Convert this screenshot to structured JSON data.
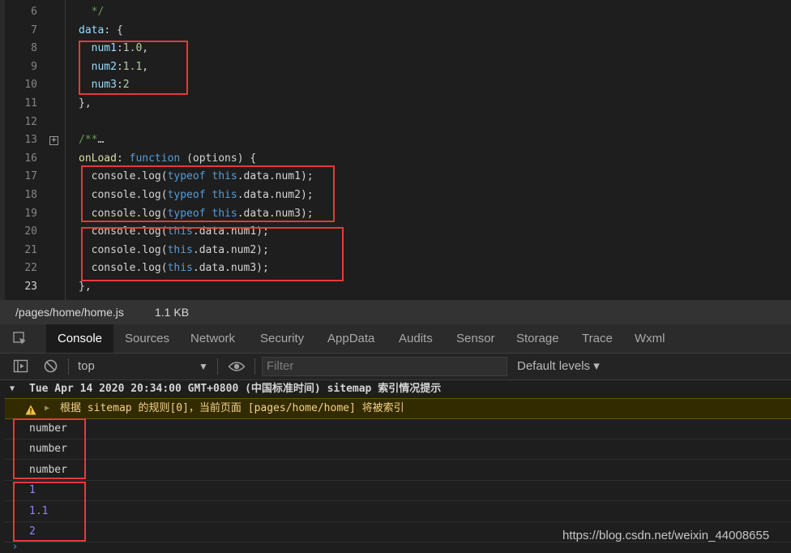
{
  "editor": {
    "current_line": "23",
    "lines": [
      {
        "num": "6",
        "parts": [
          {
            "t": "  */",
            "c": "t-c"
          }
        ]
      },
      {
        "num": "7",
        "parts": [
          {
            "t": "data",
            "c": "t-p"
          },
          {
            "t": ": {",
            "c": "t-d"
          }
        ]
      },
      {
        "num": "8",
        "parts": [
          {
            "t": "  num1",
            "c": "t-p"
          },
          {
            "t": ":",
            "c": "t-d"
          },
          {
            "t": "1.0",
            "c": "t-n"
          },
          {
            "t": ",",
            "c": "t-d"
          }
        ]
      },
      {
        "num": "9",
        "parts": [
          {
            "t": "  num2",
            "c": "t-p"
          },
          {
            "t": ":",
            "c": "t-d"
          },
          {
            "t": "1.1",
            "c": "t-n"
          },
          {
            "t": ",",
            "c": "t-d"
          }
        ]
      },
      {
        "num": "10",
        "parts": [
          {
            "t": "  num3",
            "c": "t-p"
          },
          {
            "t": ":",
            "c": "t-d"
          },
          {
            "t": "2",
            "c": "t-n"
          }
        ]
      },
      {
        "num": "11",
        "parts": [
          {
            "t": "},",
            "c": "t-d"
          }
        ]
      },
      {
        "num": "12",
        "parts": []
      },
      {
        "num": "13",
        "fold": "+",
        "parts": [
          {
            "t": "/**",
            "c": "t-c"
          },
          {
            "t": "…",
            "c": "t-d"
          }
        ]
      },
      {
        "num": "16",
        "parts": [
          {
            "t": "onLoad",
            "c": "t-f"
          },
          {
            "t": ": ",
            "c": "t-d"
          },
          {
            "t": "function",
            "c": "t-k"
          },
          {
            "t": " (options) {",
            "c": "t-d"
          }
        ]
      },
      {
        "num": "17",
        "parts": [
          {
            "t": "  console.log(",
            "c": "t-d"
          },
          {
            "t": "typeof",
            "c": "t-k"
          },
          {
            "t": " ",
            "c": "t-d"
          },
          {
            "t": "this",
            "c": "t-k"
          },
          {
            "t": ".data.num1);",
            "c": "t-d"
          }
        ]
      },
      {
        "num": "18",
        "parts": [
          {
            "t": "  console.log(",
            "c": "t-d"
          },
          {
            "t": "typeof",
            "c": "t-k"
          },
          {
            "t": " ",
            "c": "t-d"
          },
          {
            "t": "this",
            "c": "t-k"
          },
          {
            "t": ".data.num2);",
            "c": "t-d"
          }
        ]
      },
      {
        "num": "19",
        "parts": [
          {
            "t": "  console.log(",
            "c": "t-d"
          },
          {
            "t": "typeof",
            "c": "t-k"
          },
          {
            "t": " ",
            "c": "t-d"
          },
          {
            "t": "this",
            "c": "t-k"
          },
          {
            "t": ".data.num3);",
            "c": "t-d"
          }
        ]
      },
      {
        "num": "20",
        "parts": [
          {
            "t": "  console.log(",
            "c": "t-d"
          },
          {
            "t": "this",
            "c": "t-k"
          },
          {
            "t": ".data.num1);",
            "c": "t-d"
          }
        ]
      },
      {
        "num": "21",
        "parts": [
          {
            "t": "  console.log(",
            "c": "t-d"
          },
          {
            "t": "this",
            "c": "t-k"
          },
          {
            "t": ".data.num2);",
            "c": "t-d"
          }
        ]
      },
      {
        "num": "22",
        "parts": [
          {
            "t": "  console.log(",
            "c": "t-d"
          },
          {
            "t": "this",
            "c": "t-k"
          },
          {
            "t": ".data.num3);",
            "c": "t-d"
          }
        ]
      },
      {
        "num": "23",
        "parts": [
          {
            "t": "},",
            "c": "t-d"
          }
        ]
      }
    ]
  },
  "file_info": {
    "path": "/pages/home/home.js",
    "size": "1.1 KB"
  },
  "devtools": {
    "tabs": [
      "Console",
      "Sources",
      "Network",
      "Security",
      "AppData",
      "Audits",
      "Sensor",
      "Storage",
      "Trace",
      "Wxml"
    ],
    "active_tab": "Console"
  },
  "toolbar": {
    "context": "top",
    "filter_placeholder": "Filter",
    "levels": "Default levels ▾"
  },
  "console": {
    "group_header": "Tue Apr 14 2020 20:34:00 GMT+0800 (中国标准时间) sitemap 索引情况提示",
    "warning": "根据 sitemap 的规则[0]，当前页面 [pages/home/home] 将被索引",
    "outputs": [
      "number",
      "number",
      "number",
      "1",
      "1.1",
      "2"
    ]
  },
  "watermark": "https://blog.csdn.net/weixin_44008655",
  "colors": {
    "highlight_box": "#e5393b",
    "number_output": "#9980ff",
    "active_tab_bg": "#1b1b1b"
  },
  "icons": [
    "inspect-icon",
    "sidebar-toggle-icon",
    "clear-console-icon",
    "eye-icon",
    "warning-icon",
    "fold-plus-icon",
    "console-prompt-icon"
  ]
}
